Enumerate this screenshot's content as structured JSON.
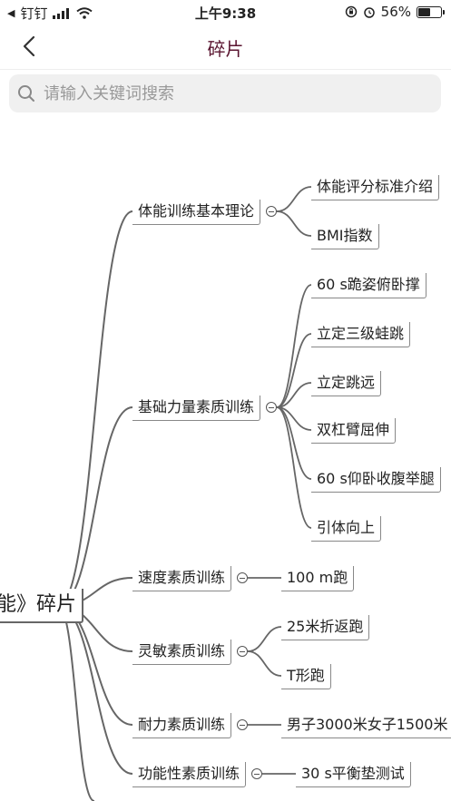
{
  "status_bar": {
    "carrier": "钉钉",
    "time": "上午9:38",
    "battery": "56%"
  },
  "nav": {
    "title": "碎片"
  },
  "search": {
    "placeholder": "请输入关键词搜索"
  },
  "mindmap": {
    "root": "能》碎片",
    "branches": [
      {
        "label": "体能训练基本理论",
        "children": [
          "体能评分标准介绍",
          "BMI指数"
        ]
      },
      {
        "label": "基础力量素质训练",
        "children": [
          "60 s跪姿俯卧撑",
          "立定三级蛙跳",
          "立定跳远",
          "双杠臂屈伸",
          "60 s仰卧收腹举腿",
          "引体向上"
        ]
      },
      {
        "label": "速度素质训练",
        "children": [
          "100 m跑"
        ]
      },
      {
        "label": "灵敏素质训练",
        "children": [
          "25米折返跑",
          "T形跑"
        ]
      },
      {
        "label": "耐力素质训练",
        "children": [
          "男子3000米女子1500米"
        ]
      },
      {
        "label": "功能性素质训练",
        "children": [
          "30 s平衡垫测试"
        ]
      }
    ]
  }
}
